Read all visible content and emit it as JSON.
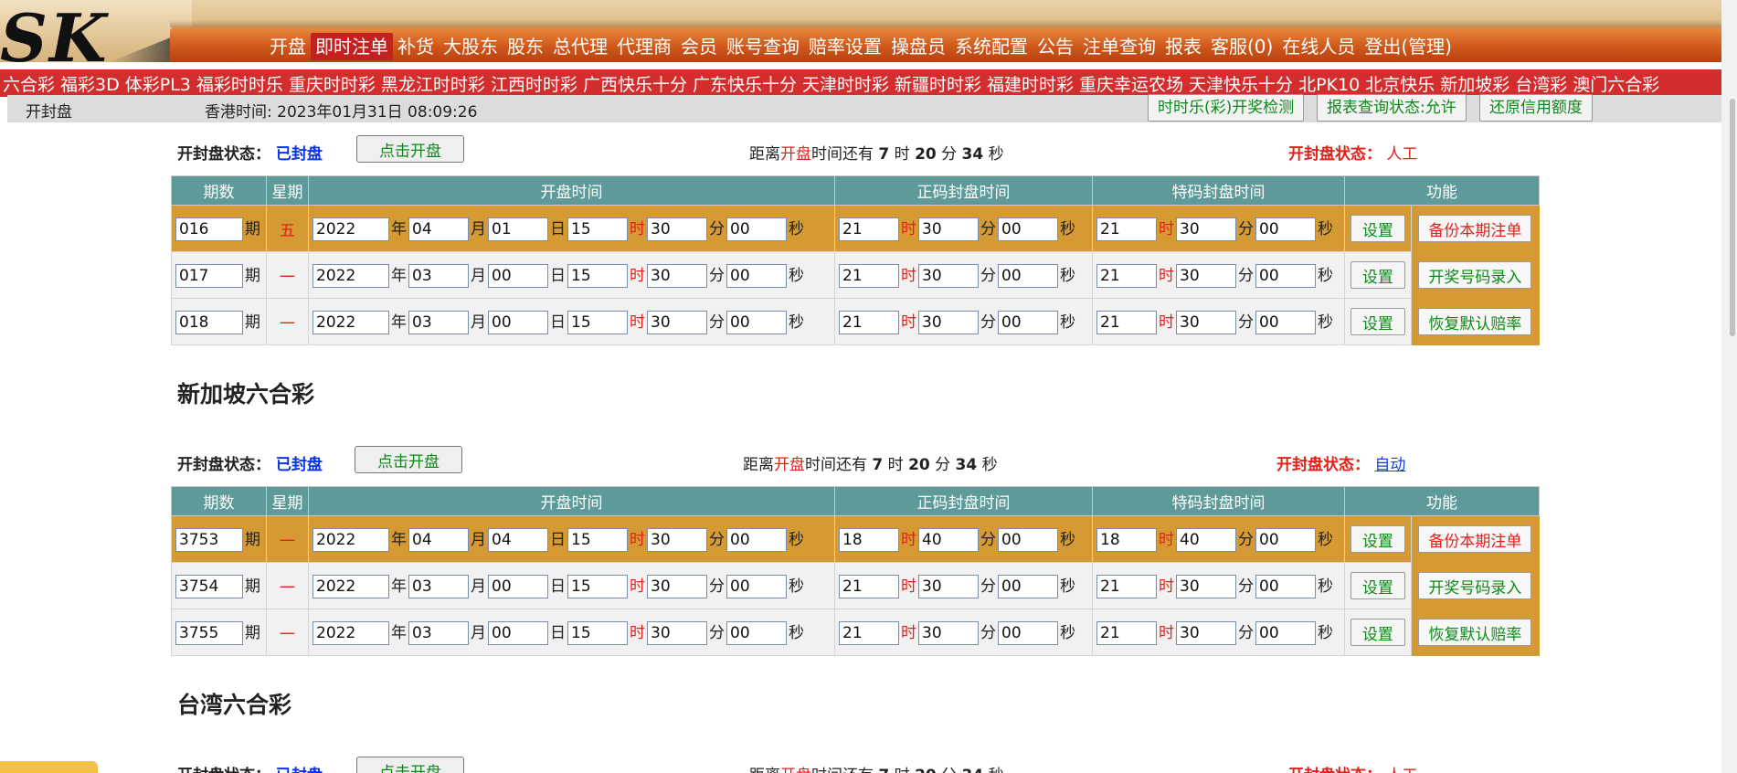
{
  "header": {
    "logo_text": "SK",
    "nav": [
      "开盘",
      "即时注单",
      "补货",
      "大股东",
      "股东",
      "总代理",
      "代理商",
      "会员",
      "账号查询",
      "赔率设置",
      "操盘员",
      "系统配置",
      "公告",
      "注单查询",
      "报表",
      "客服(0)",
      "在线人员",
      "登出(管理)"
    ],
    "active_nav": "即时注单"
  },
  "lottery_strip": [
    "六合彩",
    "福彩3D",
    "体彩PL3",
    "福彩时时乐",
    "重庆时时彩",
    "黑龙江时时彩",
    "江西时时彩",
    "广西快乐十分",
    "广东快乐十分",
    "天津时时彩",
    "新疆时时彩",
    "福建时时彩",
    "重庆幸运农场",
    "天津快乐十分",
    "北PK10",
    "北京快乐",
    "新加坡彩",
    "台湾彩",
    "澳门六合彩"
  ],
  "info_bar": {
    "title": "开封盘",
    "time": "香港时间: 2023年01月31日 08:09:26",
    "buttons": [
      "时时乐(彩)开奖检测",
      "报表查询状态:允许",
      "还原信用额度"
    ]
  },
  "labels": {
    "status_label": "开封盘状态：",
    "open_button": "点击开盘",
    "countdown_prefix": "距离",
    "countdown_mid": "开盘",
    "countdown_after": "时间还有",
    "countdown_h": "7",
    "countdown_h_unit": "时",
    "countdown_m": "20",
    "countdown_m_unit": "分",
    "countdown_s": "34",
    "countdown_s_unit": "秒",
    "mode_label": "开封盘状态：",
    "set": "设置",
    "u_qi": "期",
    "u_year": "年",
    "u_month": "月",
    "u_day": "日",
    "u_hour": "时",
    "u_min": "分",
    "u_sec": "秒",
    "func_backup": "备份本期注单",
    "func_draw": "开奖号码录入",
    "func_restore": "恢复默认赔率"
  },
  "table_headers": [
    "期数",
    "星期",
    "开盘时间",
    "正码封盘时间",
    "特码封盘时间",
    "功能"
  ],
  "sections": [
    {
      "title": "",
      "status": "已封盘",
      "mode": "人工",
      "rows": [
        {
          "qi": "016",
          "weekday": "五",
          "y": "2022",
          "mo": "04",
          "d": "01",
          "h": "15",
          "mi": "30",
          "s": "00",
          "zh": "21",
          "zm": "30",
          "zs": "00",
          "th": "21",
          "tm": "30",
          "ts": "00"
        },
        {
          "qi": "017",
          "weekday": "一",
          "y": "2022",
          "mo": "03",
          "d": "00",
          "h": "15",
          "mi": "30",
          "s": "00",
          "zh": "21",
          "zm": "30",
          "zs": "00",
          "th": "21",
          "tm": "30",
          "ts": "00"
        },
        {
          "qi": "018",
          "weekday": "一",
          "y": "2022",
          "mo": "03",
          "d": "00",
          "h": "15",
          "mi": "30",
          "s": "00",
          "zh": "21",
          "zm": "30",
          "zs": "00",
          "th": "21",
          "tm": "30",
          "ts": "00"
        }
      ]
    },
    {
      "title": "新加坡六合彩",
      "status": "已封盘",
      "mode": "自动",
      "rows": [
        {
          "qi": "3753",
          "weekday": "一",
          "y": "2022",
          "mo": "04",
          "d": "04",
          "h": "15",
          "mi": "30",
          "s": "00",
          "zh": "18",
          "zm": "40",
          "zs": "00",
          "th": "18",
          "tm": "40",
          "ts": "00"
        },
        {
          "qi": "3754",
          "weekday": "一",
          "y": "2022",
          "mo": "03",
          "d": "00",
          "h": "15",
          "mi": "30",
          "s": "00",
          "zh": "21",
          "zm": "30",
          "zs": "00",
          "th": "21",
          "tm": "30",
          "ts": "00"
        },
        {
          "qi": "3755",
          "weekday": "一",
          "y": "2022",
          "mo": "03",
          "d": "00",
          "h": "15",
          "mi": "30",
          "s": "00",
          "zh": "21",
          "zm": "30",
          "zs": "00",
          "th": "21",
          "tm": "30",
          "ts": "00"
        }
      ]
    },
    {
      "title": "台湾六合彩",
      "status": "已封盘",
      "mode": "人工",
      "rows": []
    }
  ],
  "colors": {
    "accent_red": "#e3201a",
    "header_orange": "#d0581c",
    "table_head": "#5f9a9a",
    "row_gold": "#d59a33",
    "link_blue": "#1a3fd9"
  }
}
